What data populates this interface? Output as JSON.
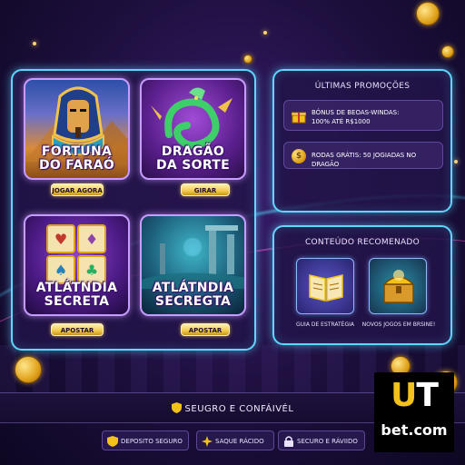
{
  "games": [
    {
      "title_line1": "FORTUNA",
      "title_line2": "DO FARAÓ",
      "button": "JOGAR AGORA"
    },
    {
      "title_line1": "DRAGÃO",
      "title_line2": "DA SORTE",
      "button": "GIRAR"
    },
    {
      "title_line1": "ATLÁTNDIA",
      "title_line2": "SECRETA",
      "button": "APOSTAR"
    },
    {
      "title_line1": "ATLÁTNDIA",
      "title_line2": "SECREGTA",
      "button": "APOSTAR"
    }
  ],
  "promotions": {
    "title": "ÚLTIMAS PROMOÇÕES",
    "items": [
      {
        "line1": "BÓNUS DE BEOAS-WINDAS:",
        "line2": "100% ATÉ R$1000",
        "icon": "gift-icon"
      },
      {
        "line1": "RODAS GRÁTIS: 50 JOGIADAS NO DRAGÃO",
        "line2": "",
        "icon": "coin-icon"
      }
    ]
  },
  "recommended": {
    "title": "CONTEÚDO RECOMENADO",
    "items": [
      {
        "label": "GUIA DE ESTRATÉGIA",
        "icon": "book-icon"
      },
      {
        "label": "NOVOS JOGOS EM BRSINE!",
        "icon": "treasure-chest-icon"
      }
    ]
  },
  "footer": {
    "title": "SEUGRO E CONFÁIVÉL",
    "badges": [
      {
        "label": "DEPOSITO SEGURO",
        "icon": "shield-icon"
      },
      {
        "label": "SAQUE RÁCIDO",
        "icon": "spark-icon"
      },
      {
        "label": "SECURO E RÁVIIDO",
        "icon": "lock-icon"
      }
    ]
  },
  "logo": {
    "main": "UT",
    "sub": "bet.com"
  },
  "colors": {
    "accent": "#5fd7ff",
    "gold": "#f2c94c",
    "background": "#1d0f3d"
  }
}
